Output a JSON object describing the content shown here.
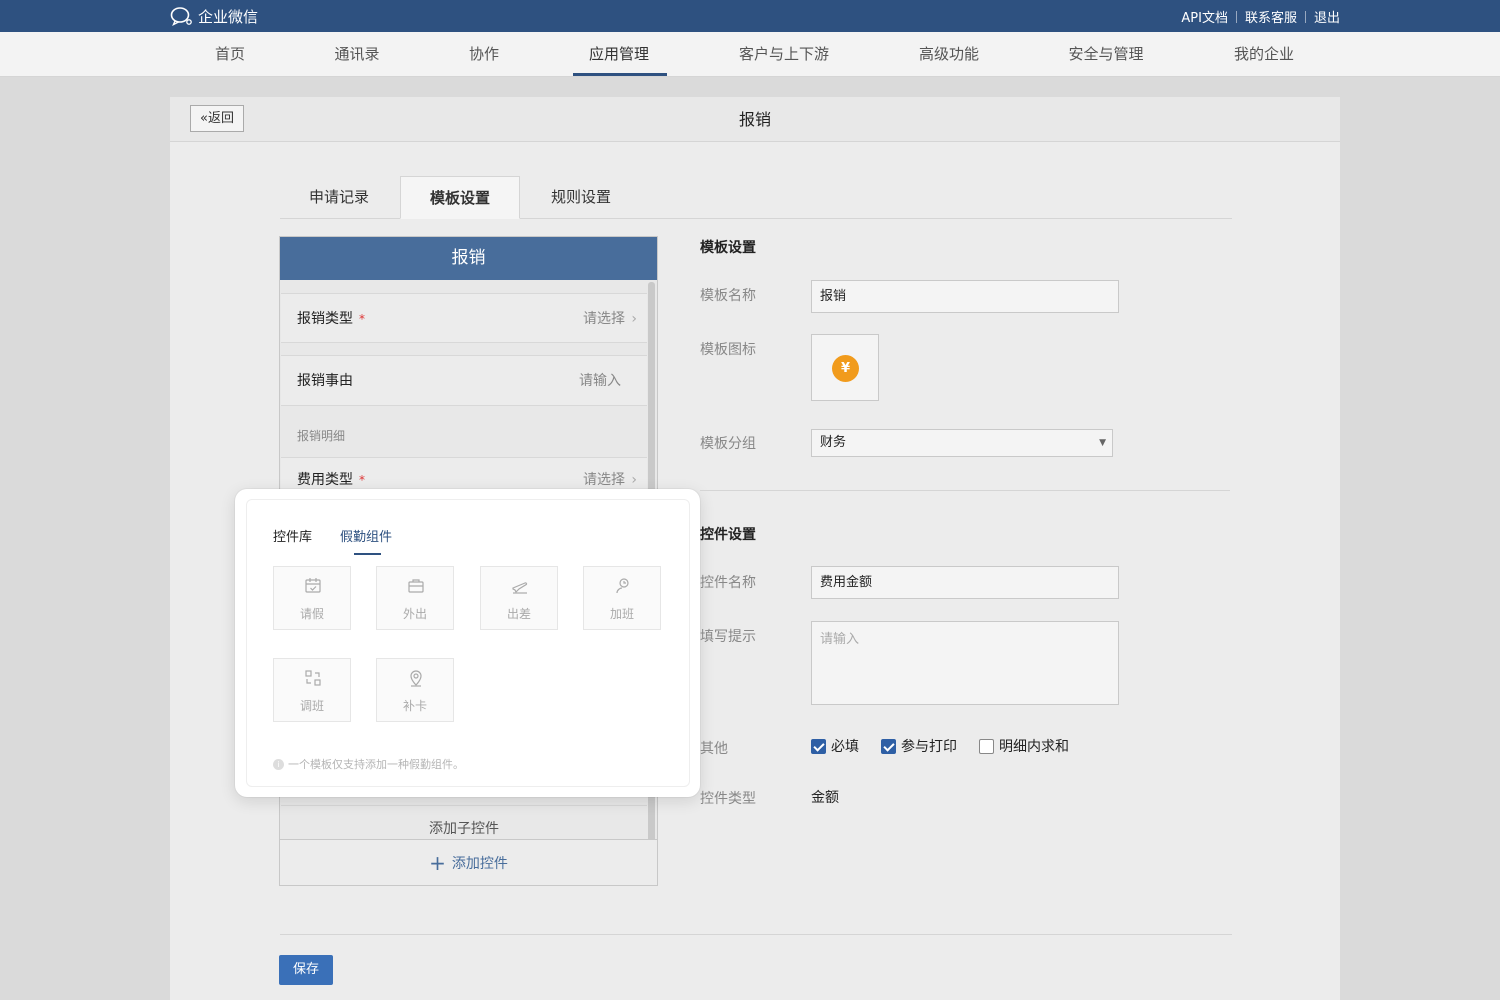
{
  "topbar": {
    "logo_text": "企业微信",
    "links": [
      "API文档",
      "联系客服",
      "退出"
    ]
  },
  "nav": {
    "items": [
      "首页",
      "通讯录",
      "协作",
      "应用管理",
      "客户与上下游",
      "高级功能",
      "安全与管理",
      "我的企业"
    ],
    "active": "应用管理"
  },
  "page": {
    "back_label": "返回",
    "title": "报销"
  },
  "tabs": [
    "申请记录",
    "模板设置",
    "规则设置"
  ],
  "phone": {
    "header": "报销",
    "rows": [
      {
        "label": "报销类型",
        "required": "*",
        "hint": "请选择"
      },
      {
        "label": "报销事由",
        "hint": "请输入"
      }
    ],
    "section_label": "报销明细",
    "detail_row": {
      "label": "费用类型",
      "required": "*",
      "hint": "请选择"
    },
    "add_sub_label": "添加子控件",
    "add_control_label": "添加控件"
  },
  "popover": {
    "tabs": [
      "控件库",
      "假勤组件"
    ],
    "active_tab": "假勤组件",
    "tiles": [
      {
        "label": "请假",
        "icon": "calendar-check-icon"
      },
      {
        "label": "外出",
        "icon": "briefcase-icon"
      },
      {
        "label": "出差",
        "icon": "plane-icon"
      },
      {
        "label": "加班",
        "icon": "person-clock-icon"
      },
      {
        "label": "调班",
        "icon": "swap-icon"
      },
      {
        "label": "补卡",
        "icon": "location-pin-icon"
      }
    ],
    "note": "一个模板仅支持添加一种假勤组件。"
  },
  "template_settings": {
    "title": "模板设置",
    "name_label": "模板名称",
    "name_value": "报销",
    "icon_label": "模板图标",
    "icon_glyph": "¥",
    "group_label": "模板分组",
    "group_value": "财务"
  },
  "control_settings": {
    "title": "控件设置",
    "name_label": "控件名称",
    "name_value": "费用金额",
    "hint_label": "填写提示",
    "hint_placeholder": "请输入",
    "other_label": "其他",
    "checks": [
      {
        "label": "必填",
        "checked": true
      },
      {
        "label": "参与打印",
        "checked": true
      },
      {
        "label": "明细内求和",
        "checked": false
      }
    ],
    "type_label": "控件类型",
    "type_value": "金额"
  },
  "save_label": "保存",
  "colors": {
    "topbar": "#2e5180",
    "phone_header": "#486d9b",
    "accent": "#2e5fa5",
    "coin": "#f19b1c",
    "required": "#dd3333"
  }
}
